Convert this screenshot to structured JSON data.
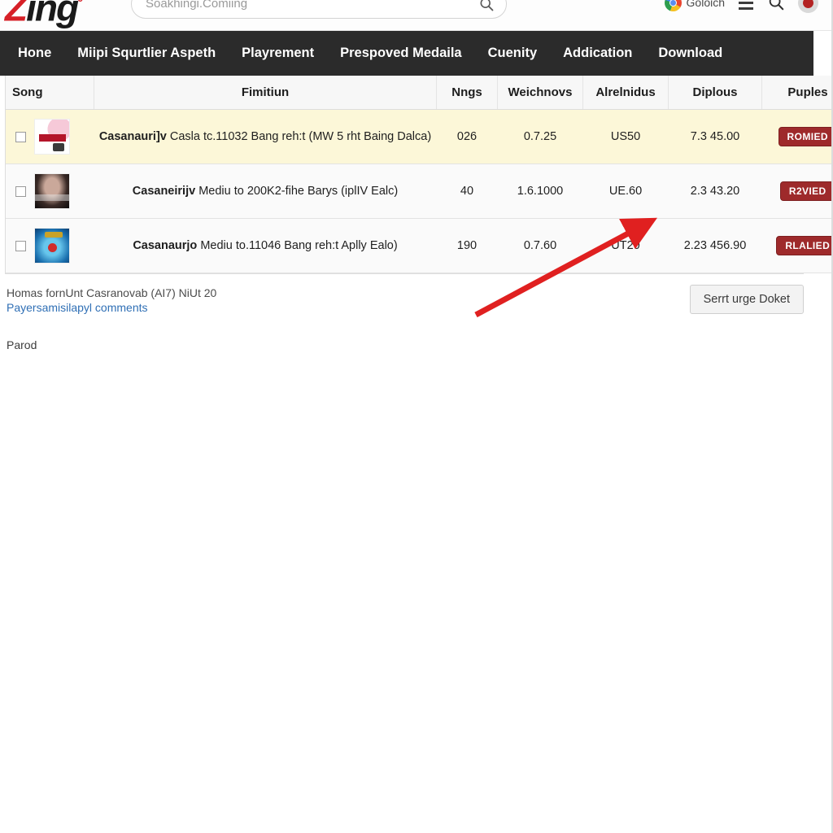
{
  "topbar": {
    "logo_z": "Z",
    "logo_ing": "ing",
    "logo_dot": "°",
    "search_placeholder": "Soakhingi.Comiing",
    "search_value": "",
    "chrome_label": "Goloich"
  },
  "nav": {
    "items": [
      {
        "label": "Hone"
      },
      {
        "label": "Miipi Squrtlier Aspeth"
      },
      {
        "label": "Playrement"
      },
      {
        "label": "Prespoved Medaila"
      },
      {
        "label": "Cuenity"
      },
      {
        "label": "Addication"
      },
      {
        "label": "Download"
      }
    ]
  },
  "table": {
    "columns": [
      {
        "label": "Song"
      },
      {
        "label": "Fimitiun"
      },
      {
        "label": "Nngs"
      },
      {
        "label": "Weichnovs"
      },
      {
        "label": "Alrelnidus"
      },
      {
        "label": "Diplous"
      },
      {
        "label": "Puples"
      }
    ],
    "rows": [
      {
        "title_bold": "Casanauri]v",
        "title_rest": "Casla tc.11032 Bang reh:t (MW 5 rht Baing Dalca)",
        "nngs": "026",
        "weichnovs": "0.7.25",
        "alrelnidus": "US50",
        "diplous": "7.3 45.00",
        "badge": "ROMIED"
      },
      {
        "title_bold": "Casaneirijv",
        "title_rest": "Mediu to 200K2-fihe Barys (iplIV Ealc)",
        "nngs": "40",
        "weichnovs": "1.6.1000",
        "alrelnidus": "UE.60",
        "diplous": "2.3 43.20",
        "badge": "R2VIED"
      },
      {
        "title_bold": "Casanaurjo",
        "title_rest": "Mediu to.11046 Bang reh:t Aplly Ealo)",
        "nngs": "190",
        "weichnovs": "0.7.60",
        "alrelnidus": "UT20",
        "diplous": "2.23 456.90",
        "badge": "RLALIED"
      }
    ]
  },
  "footer": {
    "note": "Homas fornUnt Casranovab (AI7) NiUt 20",
    "link": "Payersamisilapyl comments",
    "parod": "Parod",
    "button": "Serrt urge Doket"
  },
  "colors": {
    "nav_bg": "#2b2b2b",
    "logo_red": "#d62027",
    "badge_bg": "#9e2a2b",
    "row_highlight": "#fcf7d8",
    "link": "#2f6fb5",
    "arrow": "#e02020"
  }
}
